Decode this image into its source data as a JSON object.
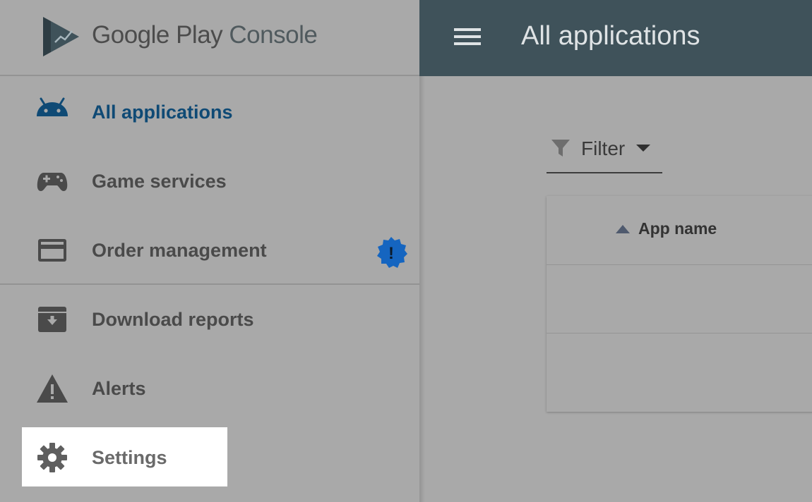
{
  "brand": {
    "name": "Google Play",
    "product": "Console"
  },
  "header": {
    "title": "All applications"
  },
  "sidebar": {
    "items": [
      {
        "label": "All applications",
        "icon": "android-icon",
        "active": true
      },
      {
        "label": "Game services",
        "icon": "gamepad-icon"
      },
      {
        "label": "Order management",
        "icon": "credit-card-icon",
        "badge": "!"
      },
      {
        "label": "Download reports",
        "icon": "download-archive-icon"
      },
      {
        "label": "Alerts",
        "icon": "warning-icon"
      },
      {
        "label": "Settings",
        "icon": "gear-icon",
        "highlighted": true
      }
    ]
  },
  "filter": {
    "label": "Filter"
  },
  "table": {
    "columns": [
      "App name"
    ]
  },
  "colors": {
    "accent": "#0f4a75",
    "header_bg": "#3f525a",
    "badge": "#1565c0",
    "overlay_bg": "#a9a9a9"
  }
}
